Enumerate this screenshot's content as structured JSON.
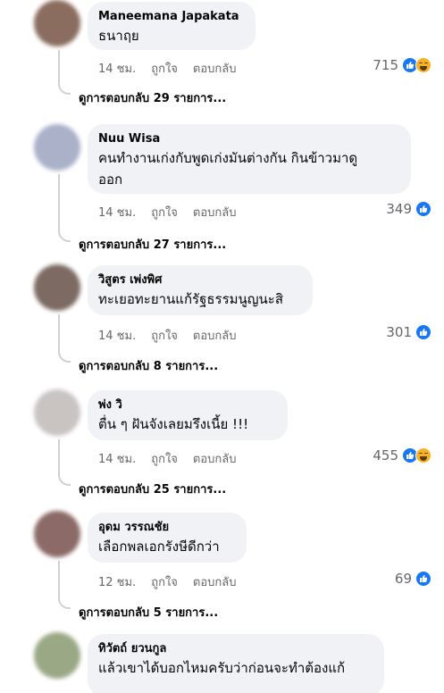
{
  "labels": {
    "like": "ถูกใจ",
    "reply": "ตอบกลับ"
  },
  "comments": [
    {
      "author": "Maneemana Japakata",
      "text": [
        "ธนาฤย"
      ],
      "time": "14 ชม.",
      "count": "715",
      "reactions": [
        "like-icon",
        "haha-icon"
      ],
      "view_replies": "ดูการตอบกลับ 29 รายการ...",
      "avatar_color": "#8a6d5e"
    },
    {
      "author": "Nuu Wisa",
      "text": [
        "คนทำงานเก่งกับพูดเก่งมันต่างกัน กินข้าวมาดู",
        "ออก"
      ],
      "time": "14 ชม.",
      "count": "349",
      "reactions": [
        "like-icon"
      ],
      "view_replies": "ดูการตอบกลับ 27 รายการ...",
      "avatar_color": "#aab1c9"
    },
    {
      "author": "วิสูตร เพ่งพิศ",
      "text": [
        "ทะเยอทะยานแก้รัฐธรรมนูญนะสิ"
      ],
      "time": "14 ชม.",
      "count": "301",
      "reactions": [
        "like-icon"
      ],
      "view_replies": "ดูการตอบกลับ 8 รายการ...",
      "avatar_color": "#7d6a63"
    },
    {
      "author": "พ่ง วิ",
      "text": [
        "ตื่น ๆ ฝันจังเลยมรึงเนี้ย !!!"
      ],
      "time": "14 ชม.",
      "count": "455",
      "reactions": [
        "like-icon",
        "haha-icon"
      ],
      "view_replies": "ดูการตอบกลับ 25 รายการ...",
      "avatar_color": "#c9c4c2"
    },
    {
      "author": "อุดม วรรณชัย",
      "text": [
        "เลือกพลเอกรังษีดีกว่า"
      ],
      "time": "12 ชม.",
      "count": "69",
      "reactions": [
        "like-icon"
      ],
      "view_replies": "ดูการตอบกลับ 5 รายการ...",
      "avatar_color": "#8c6a68"
    },
    {
      "author": "ทิวัตถ์ ยวนกูล",
      "text": [
        "แล้วเขาได้บอกไหมครับว่าก่อนจะทำต้องแก้"
      ],
      "time": "",
      "count": "",
      "reactions": [],
      "view_replies": "",
      "avatar_color": "#9aa886"
    }
  ]
}
